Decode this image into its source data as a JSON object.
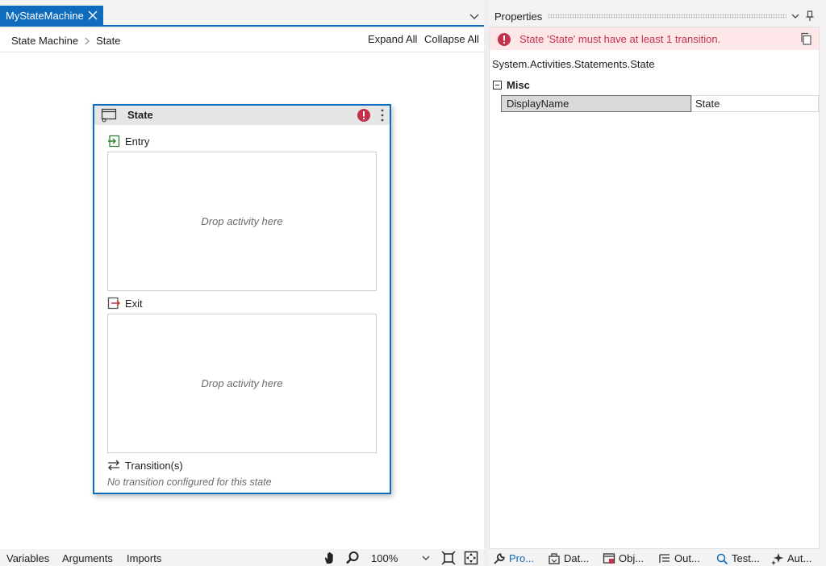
{
  "document": {
    "tab_title": "MyStateMachine"
  },
  "breadcrumb": {
    "items": [
      "State Machine",
      "State"
    ]
  },
  "toolbar": {
    "expand_all": "Expand All",
    "collapse_all": "Collapse All"
  },
  "state_card": {
    "title": "State",
    "entry_label": "Entry",
    "entry_placeholder": "Drop activity here",
    "exit_label": "Exit",
    "exit_placeholder": "Drop activity here",
    "transitions_label": "Transition(s)",
    "no_transition_text": "No transition configured for this state"
  },
  "designer_bottom": {
    "tabs": [
      "Variables",
      "Arguments",
      "Imports"
    ],
    "zoom": "100%"
  },
  "properties": {
    "title": "Properties",
    "error_message": "State 'State' must have at least 1 transition.",
    "type_name": "System.Activities.Statements.State",
    "category": "Misc",
    "rows": [
      {
        "name": "DisplayName",
        "value": "State"
      }
    ]
  },
  "panel_tabs": [
    "Pro...",
    "Dat...",
    "Obj...",
    "Out...",
    "Test...",
    "Aut..."
  ],
  "colors": {
    "accent": "#0f6cbd",
    "error": "#c4314b",
    "error_background": "#fde7e9"
  }
}
